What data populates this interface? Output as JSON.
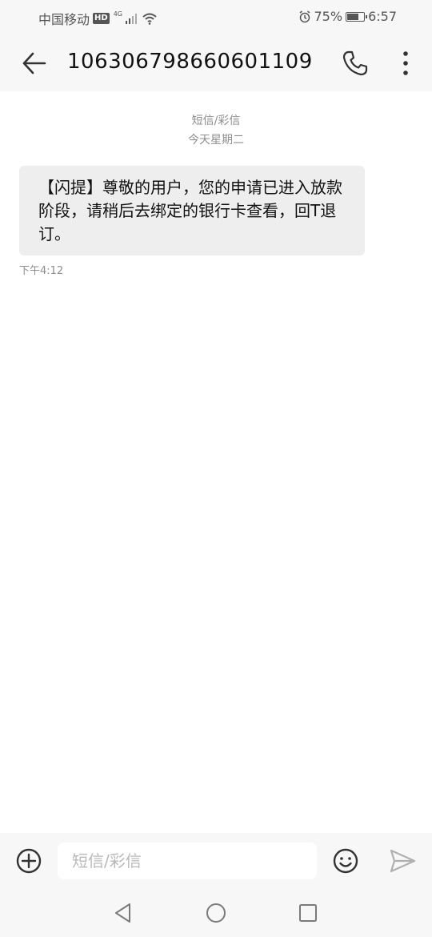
{
  "status_bar": {
    "carrier": "中国移动",
    "hd": "HD",
    "network": "4G",
    "battery_percent": "75%",
    "battery_level": 0.75,
    "time": "6:57"
  },
  "header": {
    "title": "106306798660601109",
    "icons": {
      "back": "arrow-left-icon",
      "call": "phone-icon",
      "more": "more-vertical-icon"
    }
  },
  "conversation": {
    "message_type": "短信/彩信",
    "date_label": "今天星期二",
    "messages": [
      {
        "text": "【闪提】尊敬的用户，您的申请已进入放款阶段，请稍后去绑定的银行卡查看，回T退订。",
        "time": "下午4:12"
      }
    ]
  },
  "compose": {
    "placeholder": "短信/彩信",
    "value": "",
    "icons": {
      "attach": "plus-circle-icon",
      "emoji": "smiley-icon",
      "send": "send-icon"
    }
  },
  "navigation": {
    "icons": {
      "back": "triangle-back-icon",
      "home": "circle-home-icon",
      "recent": "square-recent-icon"
    }
  },
  "colors": {
    "bar_background": "#f7f7f7",
    "bubble_background": "#eeeeee",
    "meta_text": "#8e8e8e",
    "icon": "#333333"
  }
}
